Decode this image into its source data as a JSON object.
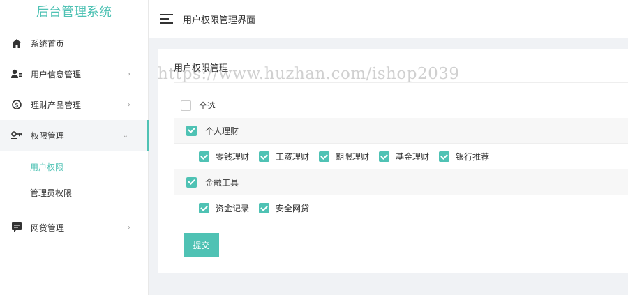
{
  "app": {
    "title": "后台管理系统"
  },
  "sidebar": {
    "items": [
      {
        "label": "系统首页",
        "icon": "home-icon"
      },
      {
        "label": "用户信息管理",
        "icon": "user-manage-icon"
      },
      {
        "label": "理财产品管理",
        "icon": "finance-product-icon"
      },
      {
        "label": "权限管理",
        "icon": "key-icon",
        "expanded": true,
        "children": [
          {
            "label": "用户权限",
            "active": true
          },
          {
            "label": "管理员权限"
          }
        ]
      },
      {
        "label": "网贷管理",
        "icon": "loan-icon"
      }
    ]
  },
  "header": {
    "title": "用户权限管理界面"
  },
  "card": {
    "title": "用户权限管理",
    "watermark": "https://www.huzhan.com/ishop2039",
    "select_all": {
      "label": "全选",
      "checked": false
    },
    "groups": [
      {
        "label": "个人理财",
        "checked": true,
        "items": [
          {
            "label": "零钱理财",
            "checked": true
          },
          {
            "label": "工资理财",
            "checked": true
          },
          {
            "label": "期限理财",
            "checked": true
          },
          {
            "label": "基金理财",
            "checked": true
          },
          {
            "label": "银行推荐",
            "checked": true
          }
        ]
      },
      {
        "label": "金融工具",
        "checked": true,
        "items": [
          {
            "label": "资金记录",
            "checked": true
          },
          {
            "label": "安全网贷",
            "checked": true
          }
        ]
      }
    ],
    "submit_label": "提交"
  },
  "colors": {
    "accent": "#4fc2b4",
    "background": "#f0f2f5"
  }
}
